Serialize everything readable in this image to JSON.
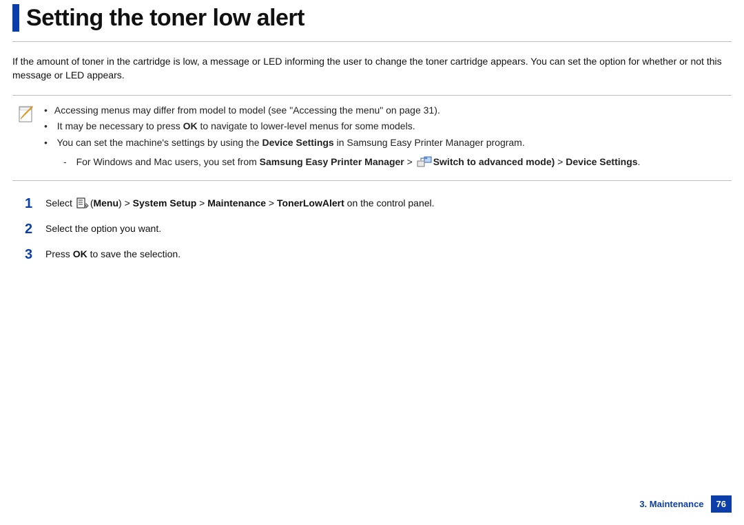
{
  "title": "Setting the toner low alert",
  "intro": "If the amount of toner in the cartridge is low, a message or LED informing the user to change the toner cartridge appears. You can set the option for whether or not this message or LED appears.",
  "note": {
    "bullet1": "Accessing menus may differ from model to model (see \"Accessing the menu\" on page 31).",
    "bullet2_pre": "It may be necessary to press ",
    "bullet2_bold": "OK",
    "bullet2_post": " to navigate to lower-level menus for some models.",
    "bullet3_pre": "You can set the machine's settings by using the ",
    "bullet3_bold": "Device Settings",
    "bullet3_post": " in Samsung Easy Printer Manager program.",
    "sub_pre": "For Windows and Mac users, you set from ",
    "sub_b1": "Samsung Easy Printer Manager",
    "sub_gt1": " > ",
    "sub_switch": "Switch to advanced mode)",
    "sub_gt2": " > ",
    "sub_b2": "Device Settings",
    "sub_period": "."
  },
  "steps": {
    "s1": {
      "num": "1",
      "pre": "Select ",
      "menu_open": "(",
      "b1": "Menu",
      "p1": ") > ",
      "b2": "System Setup",
      "p2": " > ",
      "b3": "Maintenance",
      "p3": " > ",
      "b4": "TonerLowAlert",
      "post": " on the control panel."
    },
    "s2": {
      "num": "2",
      "text": "Select the option you want."
    },
    "s3": {
      "num": "3",
      "pre": "Press ",
      "bold": "OK",
      "post": " to save the selection."
    }
  },
  "footer": {
    "section": "3. Maintenance",
    "page": "76"
  }
}
